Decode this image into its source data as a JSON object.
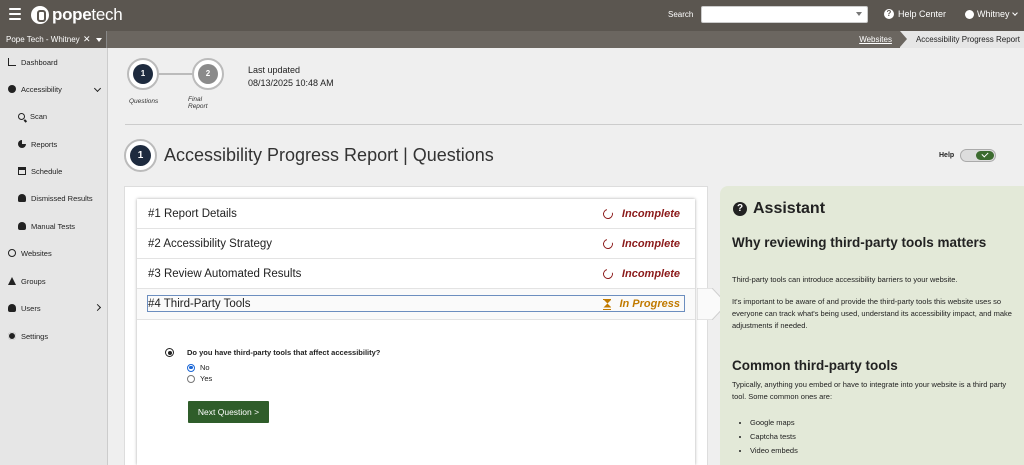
{
  "header": {
    "logo_bold": "pope",
    "logo_rest": "tech",
    "search_label": "Search",
    "search_value": "",
    "help_center": "Help Center",
    "user": "Whitney"
  },
  "subbar": {
    "org": "Pope Tech - Whitney",
    "crumbs": [
      "Websites",
      "Accessibility Progress Report"
    ]
  },
  "sidebar": {
    "items": [
      {
        "label": "Dashboard",
        "icon": "dashboard-icon"
      },
      {
        "label": "Accessibility",
        "icon": "accessibility-icon"
      },
      {
        "label": "Scan",
        "icon": "search-icon"
      },
      {
        "label": "Reports",
        "icon": "pie-chart-icon"
      },
      {
        "label": "Schedule",
        "icon": "calendar-icon"
      },
      {
        "label": "Dismissed Results",
        "icon": "bell-slash-icon"
      },
      {
        "label": "Manual Tests",
        "icon": "user-check-icon"
      },
      {
        "label": "Websites",
        "icon": "globe-icon"
      },
      {
        "label": "Groups",
        "icon": "groups-icon"
      },
      {
        "label": "Users",
        "icon": "user-icon"
      },
      {
        "label": "Settings",
        "icon": "gear-icon"
      }
    ]
  },
  "stepper": {
    "steps": [
      {
        "number": "1",
        "label": "Questions",
        "color": "#1e2b3f"
      },
      {
        "number": "2",
        "label": "Final Report",
        "color": "#8a8a8a"
      }
    ]
  },
  "last_updated": {
    "label": "Last updated",
    "value": "08/13/2025 10:48 AM"
  },
  "page": {
    "step": "1",
    "title": "Accessibility Progress Report | Questions",
    "help_label": "Help"
  },
  "questions": [
    {
      "label": "#1 Report Details",
      "status": "Incomplete"
    },
    {
      "label": "#2 Accessibility Strategy",
      "status": "Incomplete"
    },
    {
      "label": "#3 Review Automated Results",
      "status": "Incomplete"
    },
    {
      "label": "#4 Third-Party Tools",
      "status": "In Progress"
    }
  ],
  "current_question": {
    "text": "Do you have third-party tools that affect accessibility?",
    "options": [
      {
        "label": "No",
        "checked": true
      },
      {
        "label": "Yes",
        "checked": false
      }
    ],
    "next_button": "Next Question >"
  },
  "assistant": {
    "title": "Assistant",
    "heading1": "Why reviewing third-party tools matters",
    "p1": "Third-party tools can introduce accessibility barriers to your website.",
    "p2": "It's important to be aware of and provide the third-party tools this website uses so everyone can track what's being used, understand its accessibility impact, and make adjustments if needed.",
    "heading2": "Common third-party tools",
    "p3": "Typically, anything you embed or have to integrate into your website is a third party tool. Some common ones are:",
    "list": [
      "Google maps",
      "Captcha tests",
      "Video embeds"
    ]
  }
}
